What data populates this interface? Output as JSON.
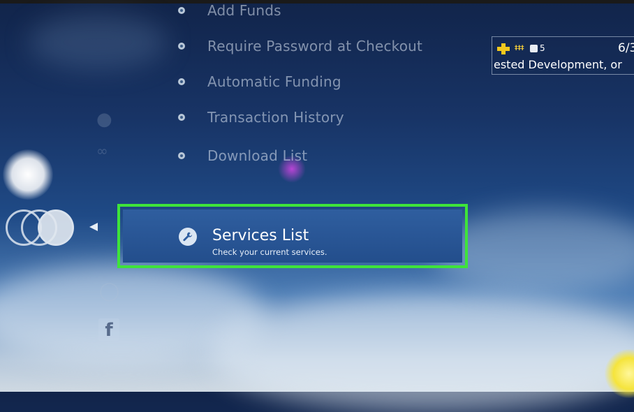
{
  "menu": {
    "items": [
      {
        "label": "Add Funds"
      },
      {
        "label": "Require Password at Checkout"
      },
      {
        "label": "Automatic Funding"
      },
      {
        "label": "Transaction History"
      },
      {
        "label": "Download List"
      }
    ]
  },
  "selected": {
    "title": "Services List",
    "subtitle": "Check your current services.",
    "icon": "wrench-icon"
  },
  "notification": {
    "count": "5",
    "date": "6/3",
    "text": "ested Development, or"
  },
  "colors": {
    "highlight_border": "#3ee43a",
    "selected_bg": "#2f5e9f"
  }
}
